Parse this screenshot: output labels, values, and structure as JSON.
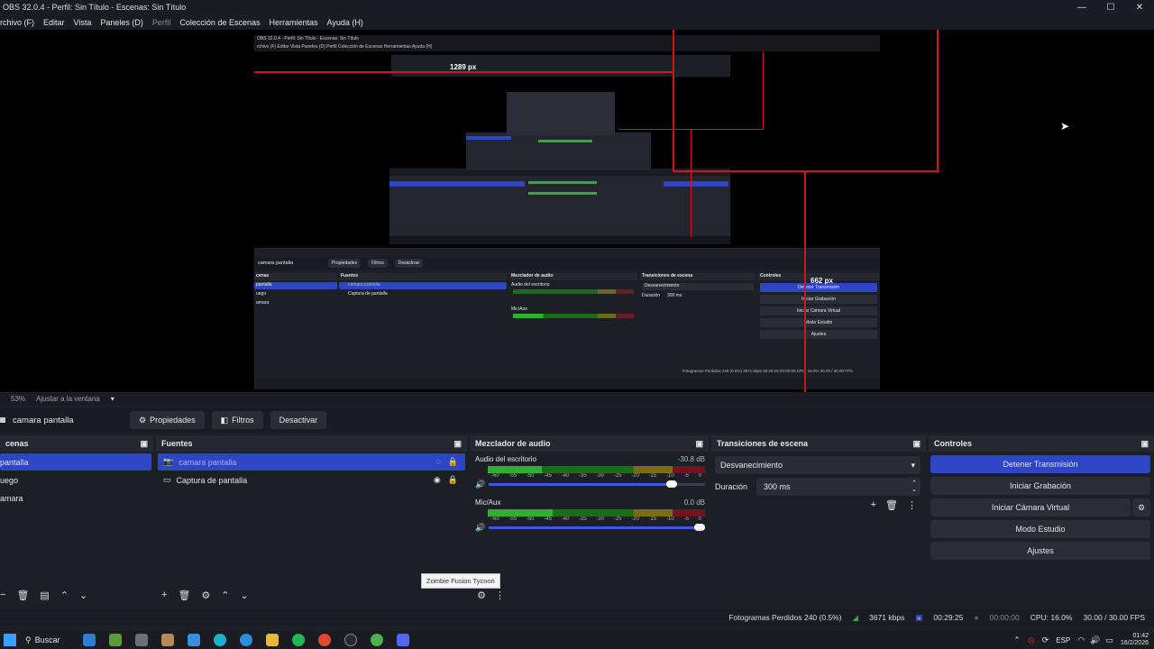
{
  "window": {
    "title": "OBS 32.0.4 - Perfil: Sin Título - Escenas: Sin Título",
    "controls": [
      "—",
      "☐",
      "✕"
    ]
  },
  "menu": [
    "rchivo (F)",
    "Editar",
    "Vista",
    "Paneles (D)",
    "Perfil",
    "Colección de Escenas",
    "Herramientas",
    "Ayuda (H)"
  ],
  "preview": {
    "label_1289": "1289 px",
    "label_662": "662 px",
    "inner_title": "OBS 32.0.4 - Perfil: Sin Título - Escenas: Sin Título",
    "inner_menu": "rchivo (F)   Editar   Vista   Paneles (D)   Perfil   Colección de Escenas   Herramientas   Ayuda (H)",
    "inner_source": "camara pantalla",
    "inner_buttons": [
      "Propiedades",
      "Filtros",
      "Desactivar"
    ],
    "inner_docks": [
      "cenas",
      "Fuentes",
      "Mezclador de audio",
      "Transiciones de escena",
      "Controles"
    ],
    "inner_scenes": [
      "pantalla",
      "uego",
      "amara"
    ],
    "inner_sources": [
      "camara pantalla",
      "Captura de pantalla"
    ],
    "inner_controls": [
      "Detener Transmisión",
      "Iniciar Grabación",
      "Iniciar Cámara Virtual",
      "Modo Estudio",
      "Ajustes"
    ],
    "inner_transition": "Desvanecimiento",
    "inner_duration_label": "Duración",
    "inner_duration": "300 ms",
    "inner_mixer": [
      "Audio del escritorio",
      "Mic/Aux"
    ],
    "inner_status": "Fotogramas Perdidos 240 (0.5%)   3671 kbps   00:29:25   00:00:00   CPU: 16.0%   30.00 / 30.00 FPS"
  },
  "zoom": {
    "percent": "53%",
    "fit": "Ajustar a la ventana"
  },
  "source_bar": {
    "current": "camara pantalla",
    "properties": "Propiedades",
    "filters": "Filtros",
    "deactivate": "Desactivar"
  },
  "scenes": {
    "title": "cenas",
    "items": [
      "pantalla",
      "uego",
      "amara"
    ]
  },
  "sources": {
    "title": "Fuentes",
    "items": [
      "camara pantalla",
      "Captura de pantalla"
    ]
  },
  "mixer": {
    "title": "Mezclador de audio",
    "channels": [
      {
        "name": "Audio del escritorio",
        "db": "-30.8 dB",
        "level": 0.25,
        "volume": 0.87
      },
      {
        "name": "Mic/Aux",
        "db": "0.0 dB",
        "level": 0.3,
        "volume": 1.0
      }
    ],
    "scale": [
      "-60",
      "-55",
      "-50",
      "-45",
      "-40",
      "-35",
      "-30",
      "-25",
      "-20",
      "-15",
      "-10",
      "-5",
      "0"
    ],
    "tooltip": "Zombie Fusion Tycoon"
  },
  "transitions": {
    "title": "Transiciones de escena",
    "selected": "Desvanecimiento",
    "duration_label": "Duración",
    "duration": "300 ms"
  },
  "controls": {
    "title": "Controles",
    "stop_stream": "Detener Transmisión",
    "start_record": "Iniciar Grabación",
    "virtual_cam": "Iniciar Cámara Virtual",
    "studio_mode": "Modo Estudio",
    "settings": "Ajustes"
  },
  "status": {
    "dropped": "Fotogramas Perdidos 240 (0.5%)",
    "bitrate": "3671 kbps",
    "stream_time": "00:29:25",
    "record_time": "00:00:00",
    "cpu": "CPU: 16.0%",
    "fps": "30.00 / 30.00 FPS"
  },
  "taskbar": {
    "search": "Buscar",
    "lang": "ESP",
    "time": "01:42",
    "date": "16/2/2026"
  },
  "colors": {
    "accent": "#2f46c4",
    "red_line": "#d0141a",
    "meter_green": "#2fb12f",
    "meter_yellow": "#b3a019",
    "meter_red": "#b21f2a"
  }
}
